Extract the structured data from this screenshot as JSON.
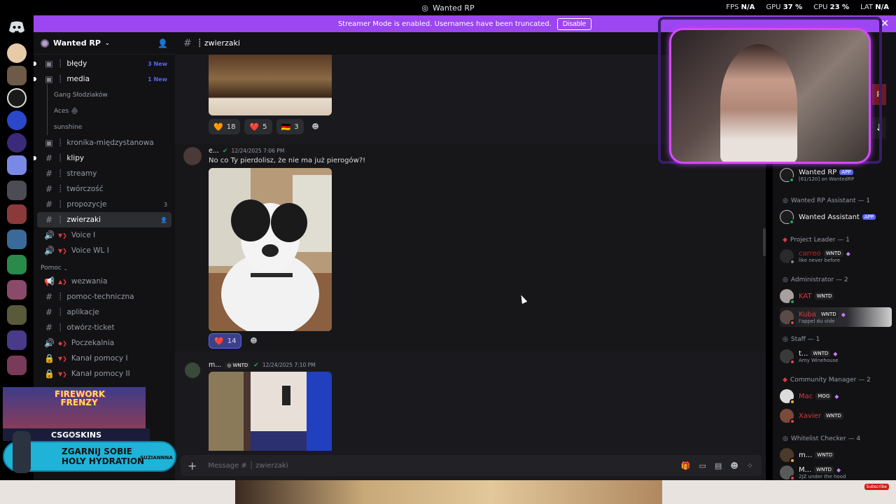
{
  "window": {
    "title": "Wanted RP"
  },
  "stats": {
    "fps_label": "FPS",
    "fps_value": "N/A",
    "gpu_label": "GPU",
    "gpu_value": "37 %",
    "cpu_label": "CPU",
    "cpu_value": "23 %",
    "lat_label": "LAT",
    "lat_value": "N/A"
  },
  "banner": {
    "text": "Streamer Mode is enabled. Usernames have been truncated.",
    "button": "Disable"
  },
  "server": {
    "name": "Wanted RP"
  },
  "channels": [
    {
      "label": "błędy",
      "badge": "3 New"
    },
    {
      "label": "media",
      "badge": "1 New"
    }
  ],
  "subchannels": [
    "Gang Słodziaków",
    "Aces ♠️",
    "sunshine"
  ],
  "channels2": [
    {
      "label": "kronika-międzystanowa"
    },
    {
      "label": "klipy"
    },
    {
      "label": "streamy"
    },
    {
      "label": "twórczość"
    },
    {
      "label": "propozycje",
      "badge": "3"
    },
    {
      "label": "zwierzaki"
    },
    {
      "label": "Voice I"
    },
    {
      "label": "Voice WL I"
    }
  ],
  "category_pomoc": "Pomoc",
  "channels3": [
    {
      "label": "wezwania"
    },
    {
      "label": "pomoc-techniczna"
    },
    {
      "label": "aplikacje"
    },
    {
      "label": "otwórz-ticket"
    },
    {
      "label": "Poczekalnia"
    },
    {
      "label": "Kanał pomocy I"
    },
    {
      "label": "Kanał pomocy II"
    }
  ],
  "chat": {
    "channel": "zwierzaki",
    "placeholder": "Message # ┊ zwierzaki",
    "reactions1": [
      {
        "emoji": "🧡",
        "count": "18"
      },
      {
        "emoji": "❤️",
        "count": "5"
      },
      {
        "emoji": "🇩🇪",
        "count": "3"
      }
    ],
    "message1": {
      "author": "e...",
      "time": "12/24/2025 7:06 PM",
      "text": "No co Ty pierdolisz, że nie ma już pierogów?!"
    },
    "reactions2": [
      {
        "emoji": "❤️",
        "count": "14"
      }
    ],
    "message2": {
      "author": "m...",
      "tag": "WNTD",
      "time": "12/24/2025 7:10 PM"
    }
  },
  "members": {
    "bot1": {
      "name": "Wanted RP",
      "tag": "APP",
      "sub": "[61/120] on WantedRP"
    },
    "group_assistant": "Wanted RP Assistant — 1",
    "bot2": {
      "name": "Wanted Assistant",
      "tag": "APP"
    },
    "group_leader": "Project Leader — 1",
    "leader": {
      "name": "carreo",
      "tag": "WNTD",
      "sub": "like never before"
    },
    "group_admin": "Administrator — 2",
    "admin1": {
      "name": "KAT",
      "tag": "WNTD"
    },
    "admin2": {
      "name": "Kuba",
      "tag": "WNTD",
      "sub": "l'appel du vide"
    },
    "group_staff": "Staff — 1",
    "staff1": {
      "name": "t...",
      "tag": "WNTD",
      "sub": "Amy Winehouse"
    },
    "group_cm": "Community Manager — 2",
    "cm1": {
      "name": "Mac",
      "tag": "MOG"
    },
    "cm2": {
      "name": "Xavier",
      "tag": "WNTD"
    },
    "group_wl": "Whitelist Checker — 4",
    "wl1": {
      "name": "m...",
      "tag": "WNTD"
    },
    "wl2": {
      "name": "M...",
      "tag": "WNTD",
      "sub": "2JZ under the hood"
    }
  },
  "promo": {
    "firework": "FIREWORK FRENZY",
    "csg": "CSG✪SKINS",
    "line1": "ZGARNIJ SOBIE",
    "line2": "HOLY HYDRATION",
    "brand": "SUZIANNNA"
  },
  "subscribe": "Subscribe"
}
